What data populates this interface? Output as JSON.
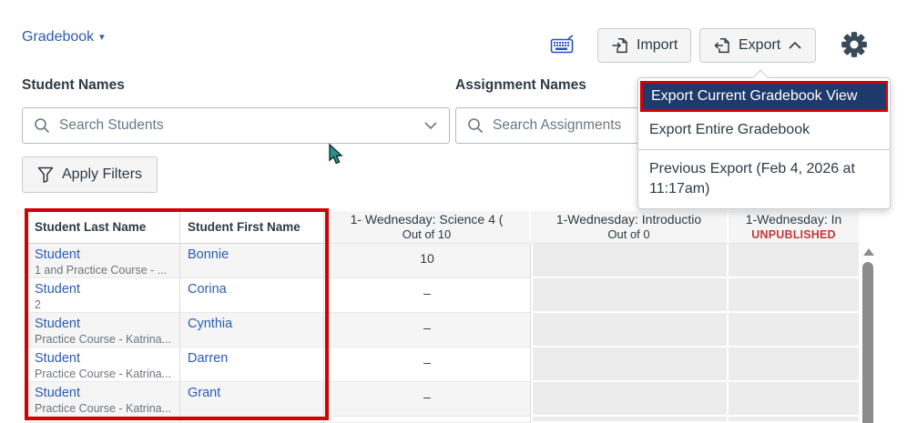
{
  "header": {
    "gradebook_menu_label": "Gradebook",
    "import_label": "Import",
    "export_label": "Export"
  },
  "filters": {
    "student_names_label": "Student Names",
    "student_search_placeholder": "Search Students",
    "assignment_names_label": "Assignment Names",
    "assignment_search_placeholder": "Search Assignments",
    "apply_filters_label": "Apply Filters"
  },
  "export_menu": {
    "items": [
      {
        "label": "Export Current Gradebook View",
        "highlighted": true
      },
      {
        "label": "Export Entire Gradebook",
        "highlighted": false
      },
      {
        "label": "Previous Export (Feb 4, 2026 at 11:17am)",
        "highlighted": false
      }
    ]
  },
  "table": {
    "columns": [
      {
        "label": "Student Last Name",
        "sub": ""
      },
      {
        "label": "Student First Name",
        "sub": ""
      },
      {
        "label": "1- Wednesday: Science 4 (",
        "sub": "Out of 10"
      },
      {
        "label": "1-Wednesday: Introductio",
        "sub": "Out of 0"
      },
      {
        "label": "1-Wednesday: In",
        "sub": "UNPUBLISHED"
      }
    ],
    "rows": [
      {
        "last": "Student",
        "sub": "1 and Practice Course - ...",
        "first": "Bonnie",
        "score": "10"
      },
      {
        "last": "Student",
        "sub": "2",
        "first": "Corina",
        "score": "–"
      },
      {
        "last": "Student",
        "sub": "Practice Course - Katrina...",
        "first": "Cynthia",
        "score": "–"
      },
      {
        "last": "Student",
        "sub": "Practice Course - Katrina...",
        "first": "Darren",
        "score": "–"
      },
      {
        "last": "Student",
        "sub": "Practice Course - Katrina...",
        "first": "Grant",
        "score": "–"
      }
    ]
  },
  "colors": {
    "link_blue": "#2b5caf",
    "menu_highlight": "#1e3a6b",
    "annotation_red": "#d40000",
    "unpublished_red": "#c23a3a",
    "button_bg": "#f5f5f5",
    "muted_cell": "#ececec"
  }
}
